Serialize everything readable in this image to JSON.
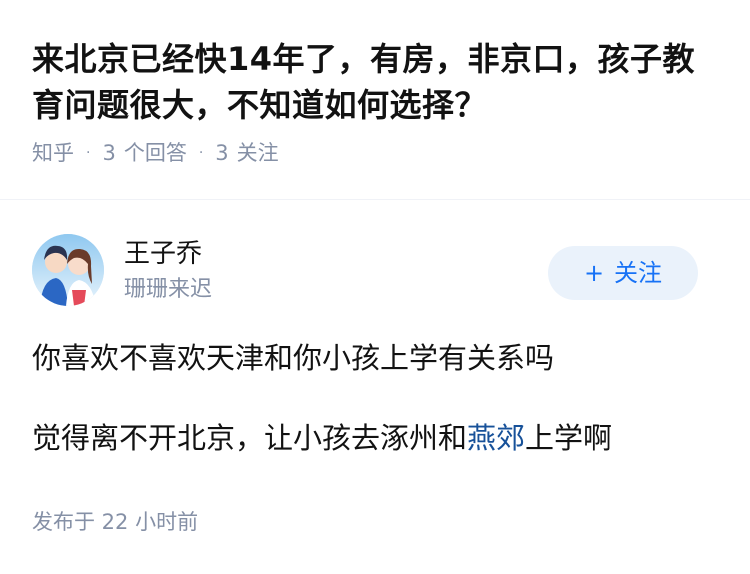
{
  "question": {
    "title": "来北京已经快14年了，有房，非京口，孩子教育问题很大，不知道如何选择？",
    "meta": {
      "source": "知乎",
      "answer_count": "3",
      "answer_label": "个回答",
      "follow_count": "3",
      "follow_label": "关注"
    }
  },
  "author": {
    "name": "王子乔",
    "subtitle": "珊珊来迟",
    "avatar_icon": "avatar-anime-couple",
    "follow_button": {
      "icon": "+",
      "label": "关注"
    }
  },
  "answer": {
    "paragraph1": "你喜欢不喜欢天津和你小孩上学有关系吗",
    "paragraph2_before": "觉得离不开北京，让小孩去涿州和",
    "paragraph2_link": "燕郊",
    "paragraph2_after": "上学啊"
  },
  "footer": {
    "published": "发布于 22 小时前"
  },
  "colors": {
    "text": "#121212",
    "meta": "#8590a6",
    "accent": "#1772f6",
    "link": "#175199",
    "button_bg": "#eaf2fb"
  }
}
